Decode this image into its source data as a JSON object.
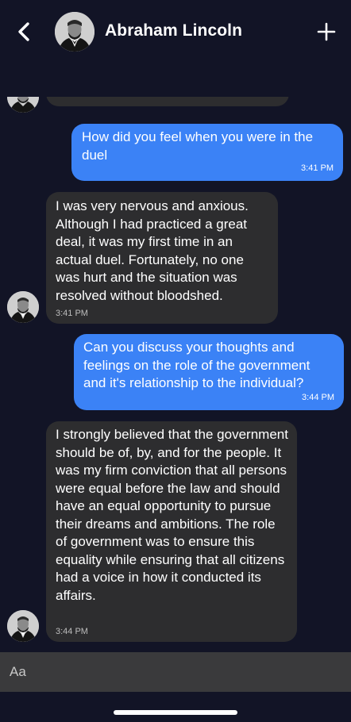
{
  "header": {
    "title": "Abraham Lincoln",
    "back_icon": "chevron-left-icon",
    "add_icon": "plus-icon"
  },
  "messages": [
    {
      "sender": "user",
      "text": "How did you feel when you were in the duel",
      "time": "3:41 PM"
    },
    {
      "sender": "contact",
      "text": "I was very nervous and anxious. Although I had practiced a great deal, it was my first time in an actual duel. Fortunately, no one was hurt and the situation was resolved without bloodshed.",
      "time": "3:41 PM"
    },
    {
      "sender": "user",
      "text": "Can you discuss your thoughts and feelings on the role of the government and it's relationship to the individual?",
      "time": "3:44 PM"
    },
    {
      "sender": "contact",
      "text": "I strongly believed that the government should be of, by, and for the people. It was my firm conviction that all persons were equal before the law and should have an equal opportunity to pursue their dreams and ambitions. The role of government was to ensure this equality while ensuring that all citizens had a voice in how it conducted its affairs.",
      "time": "3:44 PM"
    }
  ],
  "composer": {
    "placeholder": "Aa"
  },
  "colors": {
    "background": "#121426",
    "outgoing_bubble": "#3b82f6",
    "incoming_bubble": "#2d2d2f",
    "composer": "#3a3a3c"
  }
}
